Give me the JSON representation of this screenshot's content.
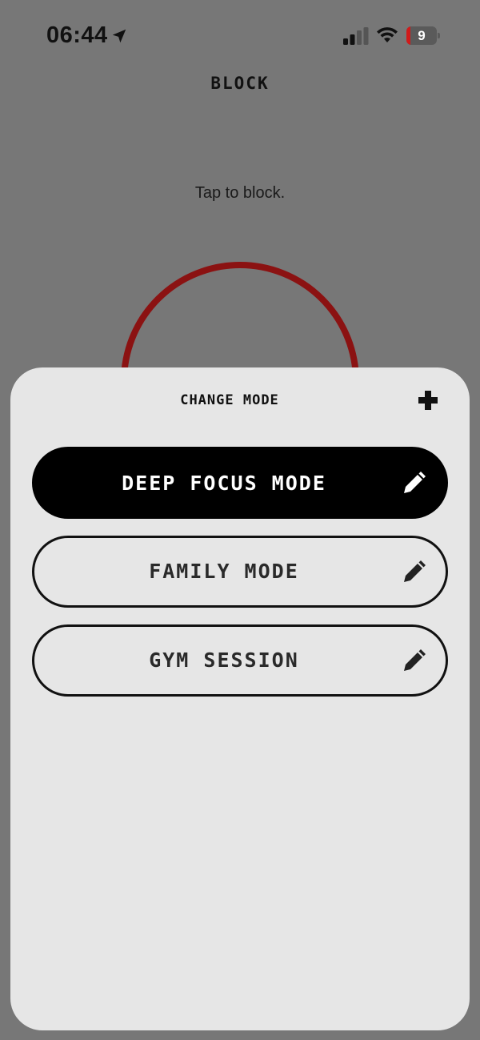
{
  "status_bar": {
    "time": "06:44",
    "battery_level": "9",
    "location_icon": "location-arrow-icon",
    "signal_icon": "cellular-signal-icon",
    "wifi_icon": "wifi-icon",
    "battery_color": "#d11a1a"
  },
  "page": {
    "title": "BLOCK",
    "hint": "Tap to block.",
    "ring_color": "#8b1212"
  },
  "sheet": {
    "title": "CHANGE MODE",
    "add_icon": "plus-icon",
    "modes": [
      {
        "label": "DEEP FOCUS MODE",
        "active": true,
        "edit_icon": "pencil-icon"
      },
      {
        "label": "FAMILY MODE",
        "active": false,
        "edit_icon": "pencil-icon"
      },
      {
        "label": "GYM SESSION",
        "active": false,
        "edit_icon": "pencil-icon"
      }
    ]
  }
}
